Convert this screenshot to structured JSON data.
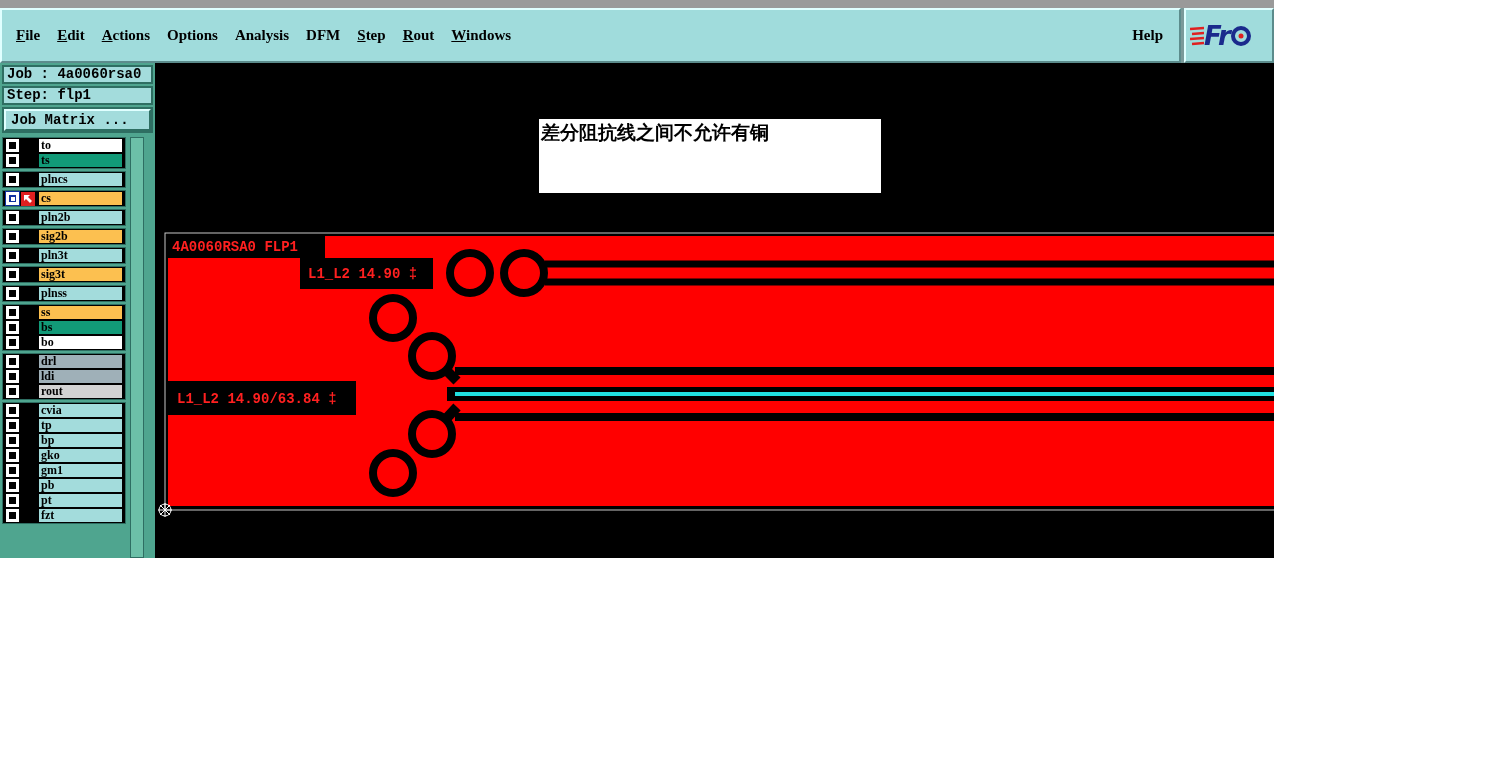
{
  "menu": [
    {
      "label": "File",
      "underlined": true
    },
    {
      "label": "Edit",
      "underlined": true
    },
    {
      "label": "Actions",
      "underlined": true
    },
    {
      "label": "Options",
      "underlined": false
    },
    {
      "label": "Analysis",
      "underlined": false
    },
    {
      "label": "DFM",
      "underlined": false
    },
    {
      "label": "Step",
      "underlined": true
    },
    {
      "label": "Rout",
      "underlined": true
    },
    {
      "label": "Windows",
      "underlined": true
    }
  ],
  "help": "Help",
  "logo": "Fr",
  "job": "Job : 4a0060rsa0",
  "step": "Step: flp1",
  "job_matrix_button": "Job Matrix ...",
  "layer_groups": [
    [
      {
        "name": "to",
        "color": "#ffffff",
        "active": false
      },
      {
        "name": "ts",
        "color": "#129a78",
        "active": false
      }
    ],
    [
      {
        "name": "plncs",
        "color": "#a3dcdc",
        "active": false
      }
    ],
    [
      {
        "name": "cs",
        "color": "#fcc050",
        "active": true
      }
    ],
    [
      {
        "name": "pln2b",
        "color": "#a3dcdc",
        "active": false
      }
    ],
    [
      {
        "name": "sig2b",
        "color": "#fcc050",
        "active": false
      }
    ],
    [
      {
        "name": "pln3t",
        "color": "#a3dcdc",
        "active": false
      }
    ],
    [
      {
        "name": "sig3t",
        "color": "#fcc050",
        "active": false
      }
    ],
    [
      {
        "name": "plnss",
        "color": "#a3dcdc",
        "active": false
      }
    ],
    [
      {
        "name": "ss",
        "color": "#fcc050",
        "active": false
      },
      {
        "name": "bs",
        "color": "#129a78",
        "active": false
      },
      {
        "name": "bo",
        "color": "#ffffff",
        "active": false
      }
    ],
    [
      {
        "name": "drl",
        "color": "#9fb0b8",
        "active": false
      },
      {
        "name": "ldi",
        "color": "#9fb0b8",
        "active": false
      },
      {
        "name": "rout",
        "color": "#d3d3d3",
        "active": false
      }
    ],
    [
      {
        "name": "cvia",
        "color": "#a3dcdc",
        "active": false
      },
      {
        "name": "tp",
        "color": "#a3dcdc",
        "active": false
      },
      {
        "name": "bp",
        "color": "#a3dcdc",
        "active": false
      },
      {
        "name": "gko",
        "color": "#a3dcdc",
        "active": false
      },
      {
        "name": "gm1",
        "color": "#a3dcdc",
        "active": false
      },
      {
        "name": "pb",
        "color": "#a3dcdc",
        "active": false
      },
      {
        "name": "pt",
        "color": "#a3dcdc",
        "active": false
      },
      {
        "name": "fzt",
        "color": "#a3dcdc",
        "active": false
      }
    ]
  ],
  "note": "差分阻抗线之间不允许有铜",
  "board_labels": [
    "4A0060RSA0 FLP1",
    "L1_L2 14.90 ‡",
    "L1_L2 14.90/63.84 ‡"
  ]
}
